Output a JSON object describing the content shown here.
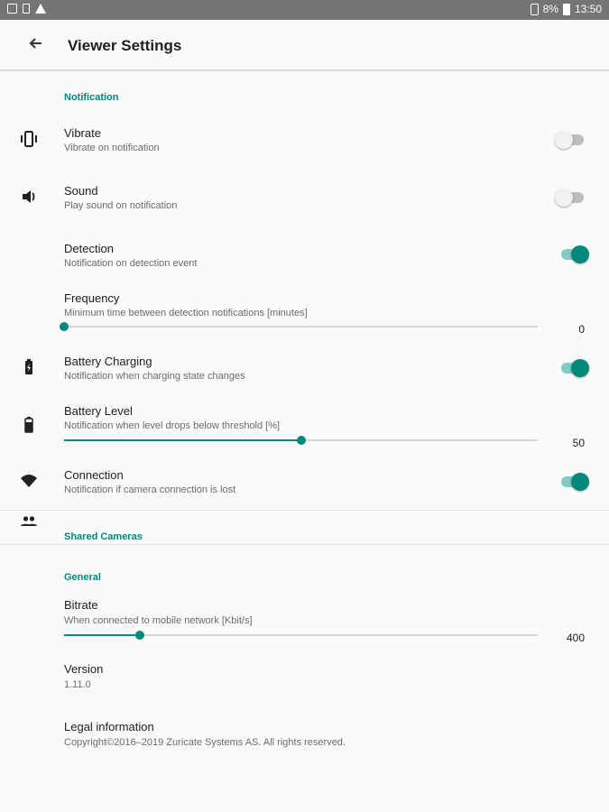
{
  "status_bar": {
    "left_icons": [
      "gallery-icon",
      "sd-card-icon",
      "warning-icon"
    ],
    "battery": "8%",
    "time": "13:50"
  },
  "header": {
    "title": "Viewer Settings"
  },
  "notification": {
    "category": "Notification",
    "vibrate": {
      "title": "Vibrate",
      "summary": "Vibrate on notification",
      "enabled": false
    },
    "sound": {
      "title": "Sound",
      "summary": "Play sound on notification",
      "enabled": false
    },
    "detection": {
      "title": "Detection",
      "summary": "Notification on detection event",
      "enabled": true
    },
    "frequency": {
      "title": "Frequency",
      "summary": "Minimum time between detection notifications [minutes]",
      "value": "0",
      "fraction": 0.0
    },
    "battery_charging": {
      "title": "Battery Charging",
      "summary": "Notification when charging state changes",
      "enabled": true
    },
    "battery_level": {
      "title": "Battery Level",
      "summary": "Notification when level drops below threshold [%]",
      "value": "50",
      "fraction": 0.5
    },
    "connection": {
      "title": "Connection",
      "summary": "Notification if camera connection is lost",
      "enabled": true
    }
  },
  "shared_cameras": {
    "category": "Shared Cameras"
  },
  "general": {
    "category": "General",
    "bitrate": {
      "title": "Bitrate",
      "summary": "When connected to mobile network [Kbit/s]",
      "value": "400",
      "fraction": 0.16
    },
    "version": {
      "title": "Version",
      "value": "1.11.0"
    },
    "legal": {
      "title": "Legal information",
      "summary": "Copyright©2016–2019 Zuricate Systems AS. All rights reserved."
    }
  },
  "colors": {
    "accent": "#00897b",
    "accent_light": "#80cbc4",
    "statusbar": "#757575"
  }
}
